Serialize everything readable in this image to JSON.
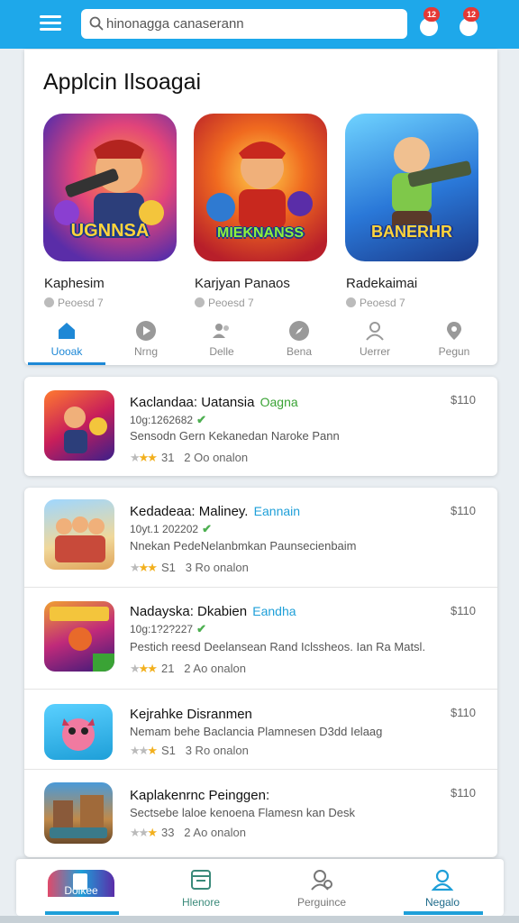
{
  "search": {
    "placeholder": "",
    "value": "hinonagga canaserann"
  },
  "notifications": [
    {
      "count": "12"
    },
    {
      "count": "12"
    }
  ],
  "featured": {
    "title": "Applcin Ilsoagai",
    "tiles": [
      {
        "art_text": "UGNNSA",
        "name": "Kaphesim",
        "sub": "Peoesd 7"
      },
      {
        "art_text": "MIEKNANSS",
        "name": "Karjyan Panaos",
        "sub": "Peoesd 7"
      },
      {
        "art_text": "BANERHR",
        "name": "Radekaimai",
        "sub": "Peoesd 7"
      }
    ]
  },
  "tabs": [
    {
      "label": "Uooak",
      "icon": "home-icon",
      "active": true
    },
    {
      "label": "Nrng",
      "icon": "play-icon",
      "active": false
    },
    {
      "label": "Delle",
      "icon": "people-icon",
      "active": false
    },
    {
      "label": "Bena",
      "icon": "compass-icon",
      "active": false
    },
    {
      "label": "Uerrer",
      "icon": "person-icon",
      "active": false
    },
    {
      "label": "Pegun",
      "icon": "location-icon",
      "active": false
    }
  ],
  "apps": [
    {
      "title": "Kaclandaa: Uatansia",
      "tag": "Oagna",
      "tag_color": "#3aa335",
      "meta": "10g:1262682",
      "desc": "Sensodn Gern Kekanedan Naroke Pann",
      "rating": 3,
      "rating_text": "31",
      "reviews": "2 Oo onalon",
      "price": "$110"
    },
    {
      "title": "Kedadeaa: Maliney.",
      "tag": "Eannain",
      "tag_color": "#1e9fd8",
      "meta": "10yt.1 202202",
      "desc": "Nnekan PedeNelanbmkan Paunsecienbaim",
      "rating": 3,
      "rating_text": "S1",
      "reviews": "3 Ro onalon",
      "price": "$110"
    },
    {
      "title": "Nadayska: Dkabien",
      "tag": "Eandha",
      "tag_color": "#1e9fd8",
      "meta": "10g:1?2?227",
      "desc": "Pestich reesd Deelansean Rand Iclssheos. Ian Ra Matsl.",
      "rating": 3,
      "rating_text": "21",
      "reviews": "2 Ao onalon",
      "price": "$110"
    },
    {
      "title": "Kejrahke Disranmen",
      "tag": "",
      "tag_color": "#1e9fd8",
      "meta": "",
      "desc": "Nemam behe Baclancia Plamnesen D3dd Ielaag",
      "rating": 2,
      "rating_text": "S1",
      "reviews": "3 Ro onalon",
      "price": "$110"
    },
    {
      "title": "Kaplakenrnc Peinggen:",
      "tag": "",
      "tag_color": "#1e9fd8",
      "meta": "",
      "desc": "Sectsebe laloe kenoena Flamesn kan Desk",
      "rating": 2,
      "rating_text": "33",
      "reviews": "2 Ao onalon",
      "price": "$110"
    }
  ],
  "bottom_nav": [
    {
      "label": "Doikee",
      "icon": "game-thumb-icon",
      "active": true
    },
    {
      "label": "Hlenore",
      "icon": "store-icon",
      "active": false
    },
    {
      "label": "Perguince",
      "icon": "user-group-icon",
      "active": false
    },
    {
      "label": "Negalo",
      "icon": "profile-icon",
      "active": true
    }
  ],
  "colors": {
    "accent": "#1ea8ea",
    "star": "#f2b01e",
    "active_tab": "#1e88d6"
  }
}
